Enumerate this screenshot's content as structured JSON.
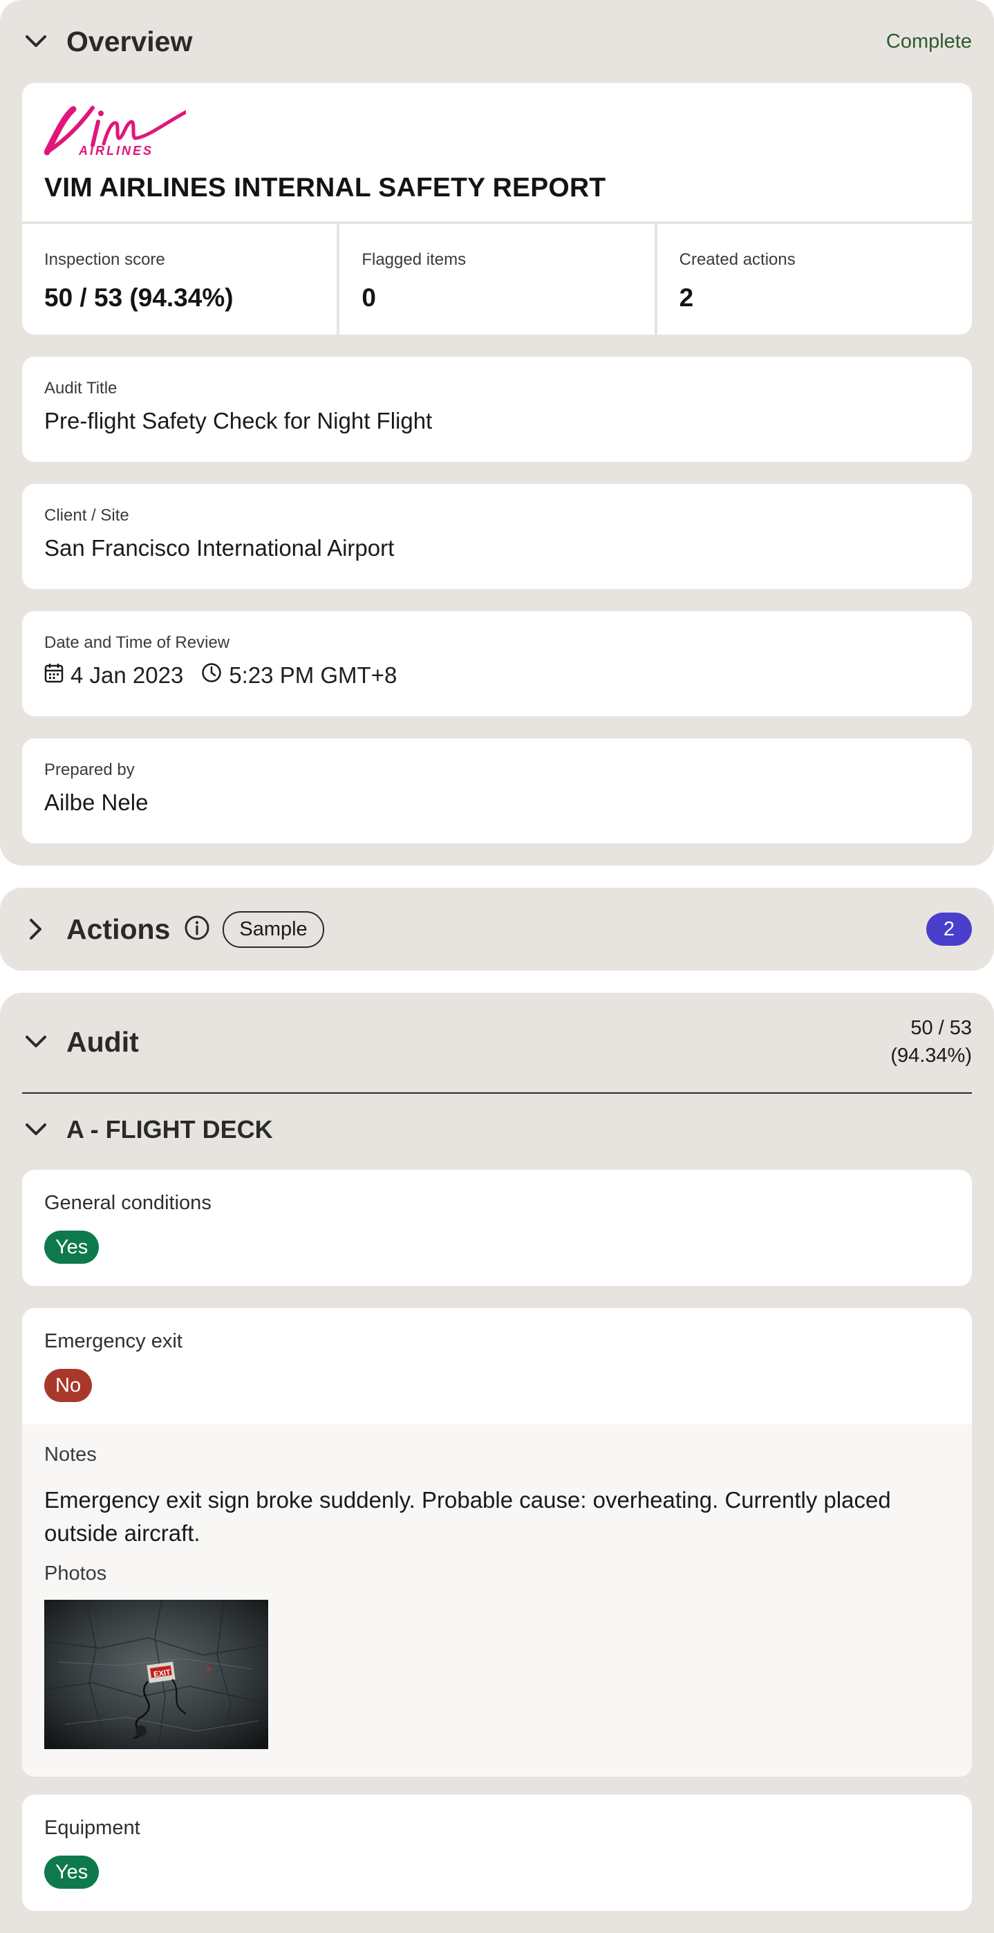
{
  "overview": {
    "title": "Overview",
    "status": "Complete",
    "logo_text": "Vim",
    "logo_subtext": "AIRLINES",
    "report_title": "VIM AIRLINES INTERNAL SAFETY REPORT",
    "stats": [
      {
        "label": "Inspection score",
        "value": "50 / 53 (94.34%)"
      },
      {
        "label": "Flagged items",
        "value": "0"
      },
      {
        "label": "Created actions",
        "value": "2"
      }
    ],
    "audit_title_label": "Audit Title",
    "audit_title_value": "Pre-flight Safety Check for Night Flight",
    "client_label": "Client / Site",
    "client_value": "San Francisco International Airport",
    "datetime_label": "Date and Time of Review",
    "date_value": "4 Jan 2023",
    "time_value": "5:23 PM GMT+8",
    "prepared_label": "Prepared by",
    "prepared_value": "Ailbe Nele"
  },
  "actions": {
    "title": "Actions",
    "sample_label": "Sample",
    "count": "2"
  },
  "audit": {
    "title": "Audit",
    "score_line1": "50 / 53",
    "score_line2": "(94.34%)",
    "section_title": "A - FLIGHT DECK",
    "questions": [
      {
        "label": "General conditions",
        "answer": "Yes"
      },
      {
        "label": "Emergency exit",
        "answer": "No"
      },
      {
        "label": "Equipment",
        "answer": "Yes"
      }
    ],
    "notes_label": "Notes",
    "notes_text": "Emergency exit sign broke suddenly. Probable cause: overheating. Currently placed outside aircraft.",
    "photos_label": "Photos",
    "photo_sign_text": "EXIT"
  },
  "colors": {
    "background": "#e7e4e0",
    "yes": "#0e7a4c",
    "no": "#a8382c",
    "badge": "#4a3fcc",
    "brand": "#e0167a",
    "complete": "#2d5a2d"
  },
  "icons": [
    "chevron-down-icon",
    "chevron-right-icon",
    "info-icon",
    "calendar-icon",
    "clock-icon"
  ]
}
